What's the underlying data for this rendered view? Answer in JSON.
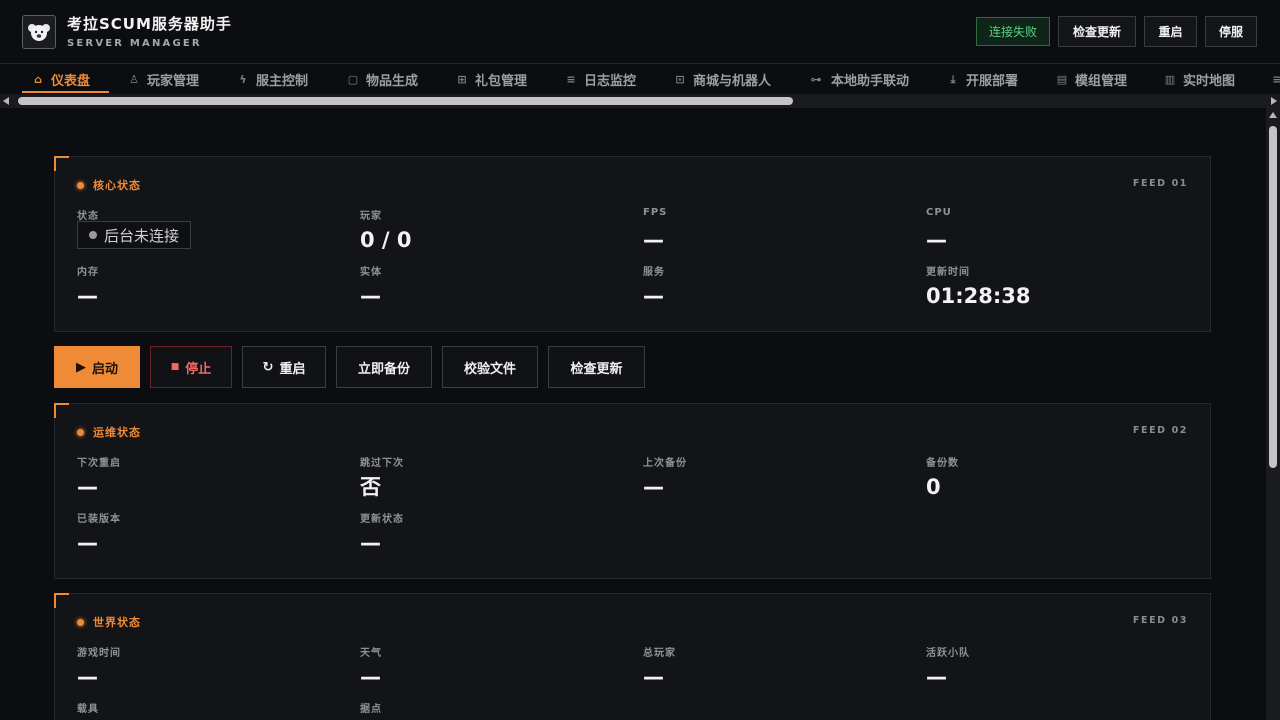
{
  "app": {
    "title": "考拉SCUM服务器助手",
    "subtitle": "SERVER MANAGER"
  },
  "header": {
    "connection_status": "连接失败",
    "check_update": "检查更新",
    "restart": "重启",
    "stop": "停服"
  },
  "nav": {
    "items": [
      {
        "label": "仪表盘",
        "icon": "home-icon"
      },
      {
        "label": "玩家管理",
        "icon": "user-icon"
      },
      {
        "label": "服主控制",
        "icon": "bolt-icon"
      },
      {
        "label": "物品生成",
        "icon": "box-icon"
      },
      {
        "label": "礼包管理",
        "icon": "gift-icon"
      },
      {
        "label": "日志监控",
        "icon": "list-icon"
      },
      {
        "label": "商城与机器人",
        "icon": "bot-icon"
      },
      {
        "label": "本地助手联动",
        "icon": "link-icon"
      },
      {
        "label": "开服部署",
        "icon": "download-icon"
      },
      {
        "label": "模组管理",
        "icon": "module-icon"
      },
      {
        "label": "实时地图",
        "icon": "map-icon"
      }
    ]
  },
  "core": {
    "title": "核心状态",
    "feed": "FEED 01",
    "status_label": "状态",
    "status_value": "后台未连接",
    "players_label": "玩家",
    "players_value": "0 / 0",
    "fps_label": "FPS",
    "fps_value": "—",
    "cpu_label": "CPU",
    "cpu_value": "—",
    "memory_label": "内存",
    "memory_value": "—",
    "entities_label": "实体",
    "entities_value": "—",
    "service_label": "服务",
    "service_value": "—",
    "updated_label": "更新时间",
    "updated_value": "01:28:38"
  },
  "actions": {
    "start": "启动",
    "stop": "停止",
    "restart": "重启",
    "backup": "立即备份",
    "verify": "校验文件",
    "check_update": "检查更新"
  },
  "ops": {
    "title": "运维状态",
    "feed": "FEED 02",
    "next_restart_label": "下次重启",
    "next_restart_value": "—",
    "skip_next_label": "跳过下次",
    "skip_next_value": "否",
    "last_backup_label": "上次备份",
    "last_backup_value": "—",
    "backup_count_label": "备份数",
    "backup_count_value": "0",
    "version_label": "已装版本",
    "version_value": "—",
    "update_status_label": "更新状态",
    "update_status_value": "—"
  },
  "world": {
    "title": "世界状态",
    "feed": "FEED 03",
    "game_time_label": "游戏时间",
    "game_time_value": "—",
    "weather_label": "天气",
    "weather_value": "—",
    "total_players_label": "总玩家",
    "total_players_value": "—",
    "active_squads_label": "活跃小队",
    "active_squads_value": "—",
    "vehicles_label": "载具",
    "bases_label": "据点"
  },
  "colors": {
    "accent": "#ef8a37",
    "danger": "#f06a6a",
    "success": "#5ad07e",
    "background": "#0c0d10",
    "panel": "#131418"
  }
}
